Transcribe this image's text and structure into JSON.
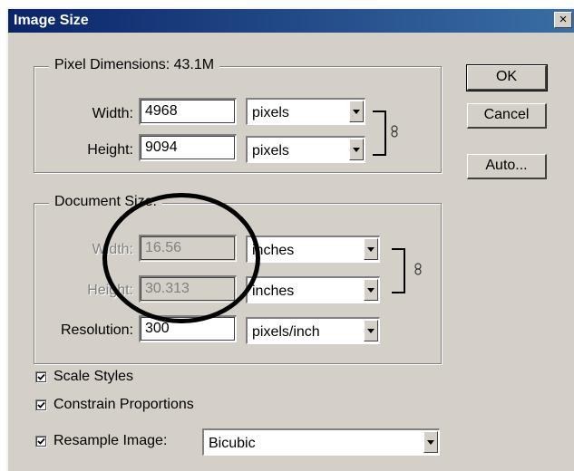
{
  "window": {
    "title": "Image Size",
    "close_glyph": "×"
  },
  "pixel_dimensions": {
    "legend": "Pixel Dimensions:  43.1M",
    "width_label": "Width:",
    "width_value": "4968",
    "width_unit": "pixels",
    "height_label": "Height:",
    "height_value": "9094",
    "height_unit": "pixels"
  },
  "document_size": {
    "legend": "Document Size:",
    "width_label": "Width:",
    "width_value": "16.56",
    "width_unit": "inches",
    "height_label": "Height:",
    "height_value": "30.313",
    "height_unit": "inches",
    "resolution_label": "Resolution:",
    "resolution_value": "300",
    "resolution_unit": "pixels/inch"
  },
  "buttons": {
    "ok": "OK",
    "cancel": "Cancel",
    "auto": "Auto..."
  },
  "options": {
    "scale_styles": {
      "label": "Scale Styles",
      "checked": true
    },
    "constrain_proportions": {
      "label": "Constrain Proportions",
      "checked": true
    },
    "resample_image": {
      "label": "Resample Image:",
      "checked": true,
      "method": "Bicubic"
    }
  },
  "icons": {
    "link": "chain-link-icon",
    "dropdown": "chevron-down-icon",
    "checkmark": "checkmark-icon"
  },
  "colors": {
    "dialog_bg": "#d4d0c8",
    "titlebar": "#0a246a",
    "annotation": "#000000"
  }
}
